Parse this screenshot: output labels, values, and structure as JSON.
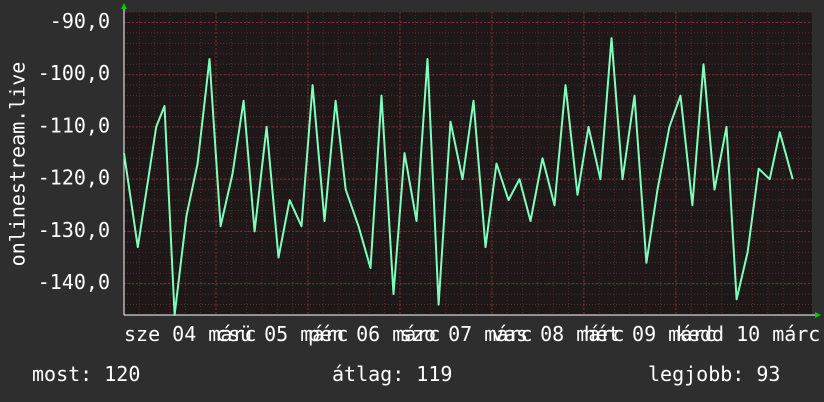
{
  "chart_data": {
    "type": "line",
    "title": "",
    "xlabel": "",
    "ylabel": "onlinestream.live",
    "ylim": [
      -146,
      -88
    ],
    "yticks": [
      -90,
      -100,
      -110,
      -120,
      -130,
      -140
    ],
    "ytick_labels": [
      "-90,0",
      "-100,0",
      "-110,0",
      "-120,0",
      "-130,0",
      "-140,0"
    ],
    "xlim": [
      0,
      7.48
    ],
    "xticks": [
      {
        "pos": 0.0,
        "label": "sze 04 márc"
      },
      {
        "pos": 1.0,
        "label": "csü 05 márc"
      },
      {
        "pos": 2.0,
        "label": "pén 06 márc"
      },
      {
        "pos": 3.0,
        "label": "szo 07 márc"
      },
      {
        "pos": 4.0,
        "label": "vas 08 márc"
      },
      {
        "pos": 5.0,
        "label": "hét 09 márc"
      },
      {
        "pos": 6.0,
        "label": "kedd 10 márc"
      }
    ],
    "grid": true,
    "line_color": "#7fffbf",
    "series": [
      {
        "name": "",
        "x": [
          0.0,
          0.15,
          0.35,
          0.44,
          0.55,
          0.68,
          0.8,
          0.93,
          1.05,
          1.18,
          1.3,
          1.42,
          1.55,
          1.68,
          1.8,
          1.93,
          2.05,
          2.18,
          2.3,
          2.41,
          2.55,
          2.68,
          2.8,
          2.93,
          3.05,
          3.18,
          3.3,
          3.42,
          3.55,
          3.68,
          3.8,
          3.93,
          4.05,
          4.18,
          4.3,
          4.42,
          4.55,
          4.68,
          4.8,
          4.93,
          5.05,
          5.18,
          5.3,
          5.42,
          5.55,
          5.68,
          5.8,
          5.93,
          6.05,
          6.18,
          6.3,
          6.42,
          6.55,
          6.66,
          6.78,
          6.9,
          7.02,
          7.13,
          7.27
        ],
        "y": [
          -115,
          -133,
          -110,
          -106,
          -146,
          -127,
          -117,
          -97,
          -129,
          -119,
          -105,
          -130,
          -110,
          -135,
          -124,
          -129,
          -102,
          -128,
          -105,
          -122,
          -129,
          -137,
          -104,
          -142,
          -115,
          -128,
          -97,
          -144,
          -109,
          -120,
          -105,
          -133,
          -117,
          -124,
          -120,
          -128,
          -116,
          -125,
          -102,
          -123,
          -110,
          -120,
          -93,
          -120,
          -104,
          -136,
          -122,
          -110,
          -104,
          -125,
          -98,
          -122,
          -110,
          -143,
          -134,
          -118,
          -120,
          -111,
          -120
        ]
      }
    ]
  },
  "stats": {
    "current": "most: 120",
    "average": "átlag: 119",
    "best": "legjobb: 93"
  },
  "colors": {
    "background": "#2e2e2e",
    "plot_background": "#1e1818",
    "grid_minor": "#5a2a2a",
    "grid_major": "#7a3030",
    "axis_arrow": "#00cc00",
    "line": "#7fffbf",
    "text": "#ffffff"
  }
}
